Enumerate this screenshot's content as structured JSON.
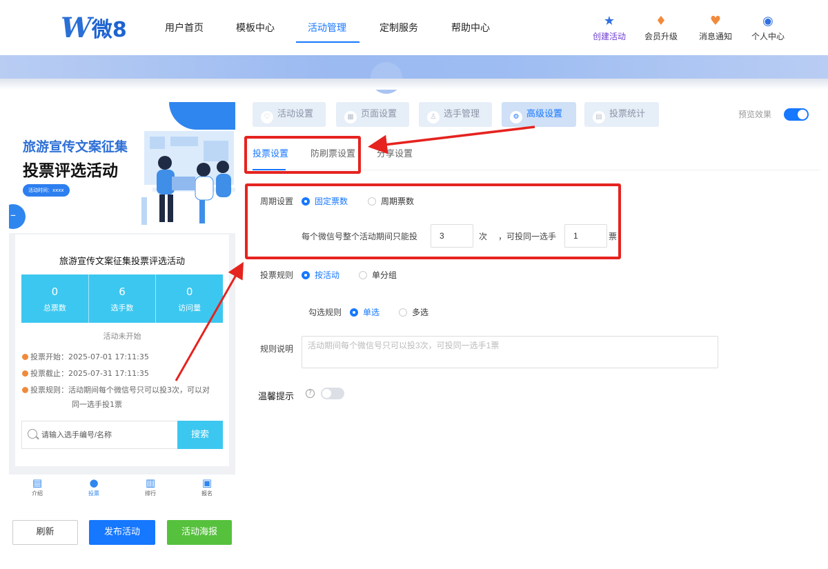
{
  "logo": {
    "letter": "W",
    "text": "微8"
  },
  "nav": {
    "items": [
      "用户首页",
      "模板中心",
      "活动管理",
      "定制服务",
      "帮助中心"
    ],
    "right": [
      "创建活动",
      "会员升级",
      "消息通知",
      "个人中心"
    ]
  },
  "preview": {
    "poster_title1": "旅游宣传文案征集",
    "poster_title2": "投票评选活动",
    "poster_time": "活动时间：xxxx",
    "card_title": "旅游宣传文案征集投票评选活动",
    "stats": [
      {
        "num": "0",
        "label": "总票数"
      },
      {
        "num": "6",
        "label": "选手数"
      },
      {
        "num": "0",
        "label": "访问量"
      }
    ],
    "status": "活动未开始",
    "vote_start": "投票开始：2025-07-01 17:11:35",
    "vote_end": "投票截止：2025-07-31 17:11:35",
    "vote_rule_line1": "投票规则：活动期间每个微信号只可以投3次，可以对",
    "vote_rule_line2": "同一选手投1票",
    "search_placeholder": "请输入选手编号/名称",
    "search_btn": "搜索",
    "tabs": [
      "介绍",
      "投票",
      "排行",
      "报名"
    ]
  },
  "actions": {
    "refresh": "刷新",
    "publish": "发布活动",
    "poster": "活动海报"
  },
  "steps": [
    "活动设置",
    "页面设置",
    "选手管理",
    "高级设置",
    "投票统计"
  ],
  "preview_toggle_label": "预览效果",
  "subtabs": [
    "投票设置",
    "防刷票设置",
    "分享设置"
  ],
  "form": {
    "period_label": "周期设置",
    "period_options": [
      "固定票数",
      "周期票数"
    ],
    "limit_prefix": "每个微信号整个活动期间只能投",
    "limit_value": "3",
    "limit_unit": "次",
    "same_prefix": "，可投同一选手",
    "same_value": "1",
    "same_unit": "票",
    "rule_label": "投票规则",
    "rule_options": [
      "按活动",
      "单分组"
    ],
    "select_label": "勾选规则",
    "select_options": [
      "单选",
      "多选"
    ],
    "desc_label": "规则说明",
    "desc_placeholder": "活动期间每个微信号只可以投3次，可投同一选手1票",
    "tip_label": "温馨提示"
  },
  "colors": {
    "accent": "#1677ff",
    "annotation": "#e5231f",
    "cyan": "#3cc7f0",
    "green": "#56c13d"
  }
}
